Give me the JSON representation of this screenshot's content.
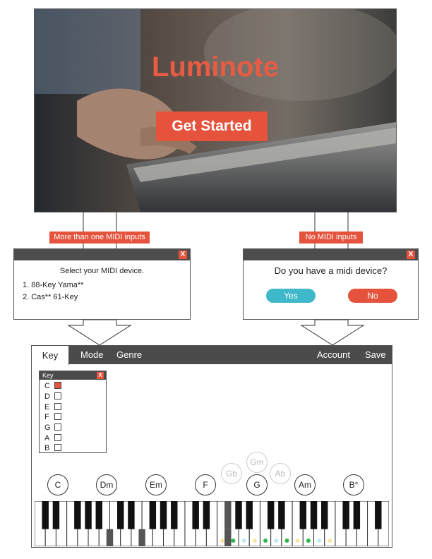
{
  "hero": {
    "title": "Luminote",
    "cta_label": "Get Started"
  },
  "flows": {
    "multiple_inputs": "More than one MIDI inputs",
    "no_inputs": "No MIDI inputs"
  },
  "select_dialog": {
    "close_label": "X",
    "prompt": "Select your MIDI device.",
    "devices": [
      "1. 88-Key Yama**",
      "2. Cas** 61-Key"
    ]
  },
  "midi_dialog": {
    "close_label": "X",
    "question": "Do you have a midi device?",
    "yes_label": "Yes",
    "no_label": "No"
  },
  "app": {
    "tabs": [
      "Key",
      "Mode",
      "Genre"
    ],
    "right_links": [
      "Account",
      "Save"
    ],
    "key_panel": {
      "title": "Key",
      "close_label": "X",
      "keys": [
        {
          "label": "C",
          "checked": true
        },
        {
          "label": "D",
          "checked": false
        },
        {
          "label": "E",
          "checked": false
        },
        {
          "label": "F",
          "checked": false
        },
        {
          "label": "G",
          "checked": false
        },
        {
          "label": "A",
          "checked": false
        },
        {
          "label": "B",
          "checked": false
        }
      ]
    },
    "chords": [
      "C",
      "Dm",
      "Em",
      "F",
      "G",
      "Am",
      "B°"
    ],
    "chord_suggestions": [
      "Gm",
      "Gb",
      "Ab"
    ]
  },
  "colors": {
    "accent": "#e5533d",
    "yes_button": "#3fb8c9",
    "bar": "#4b4b4b",
    "dot_yellow": "#f6e7a6",
    "dot_green": "#2cb84a",
    "dot_cyan": "#bfeaf2",
    "black_key_shaded": "#555555"
  }
}
